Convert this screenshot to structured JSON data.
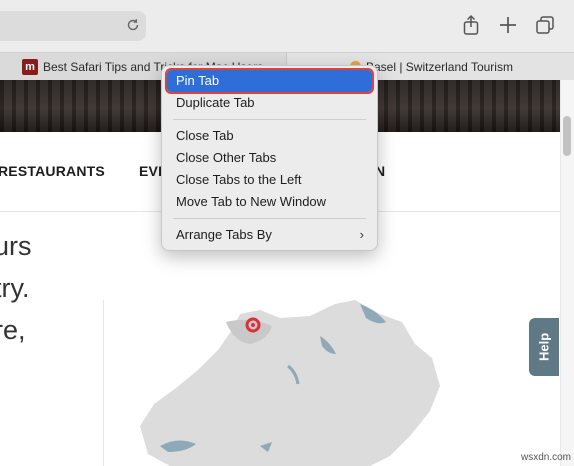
{
  "toolbar": {
    "reload_icon": "reload-icon",
    "share_icon": "share-icon",
    "new_tab_icon": "plus-icon",
    "tabs_overview_icon": "tab-overview-icon"
  },
  "tabs": [
    {
      "title": "Best Safari Tips and Tricks for Mac Users",
      "favicon": "m",
      "close_label": "×"
    },
    {
      "title": "Basel | Switzerland Tourism"
    }
  ],
  "page": {
    "nav": [
      "RESTAURANTS",
      "EVE",
      "N"
    ],
    "hero_lines": [
      "urs",
      "try.",
      "re,"
    ],
    "help_label": "Help"
  },
  "context_menu": {
    "items": [
      {
        "label": "Pin Tab",
        "selected": true
      },
      {
        "label": "Duplicate Tab"
      },
      {
        "separator": true
      },
      {
        "label": "Close Tab"
      },
      {
        "label": "Close Other Tabs"
      },
      {
        "label": "Close Tabs to the Left"
      },
      {
        "label": "Move Tab to New Window"
      },
      {
        "separator": true
      },
      {
        "label": "Arrange Tabs By",
        "submenu_arrow": "›"
      }
    ]
  },
  "watermark": "wsxdn.com",
  "colors": {
    "selection_blue": "#2f6ed8",
    "highlight_red": "#e0413a",
    "help_tab": "#5f7a86",
    "map_marker": "#d9303a"
  }
}
